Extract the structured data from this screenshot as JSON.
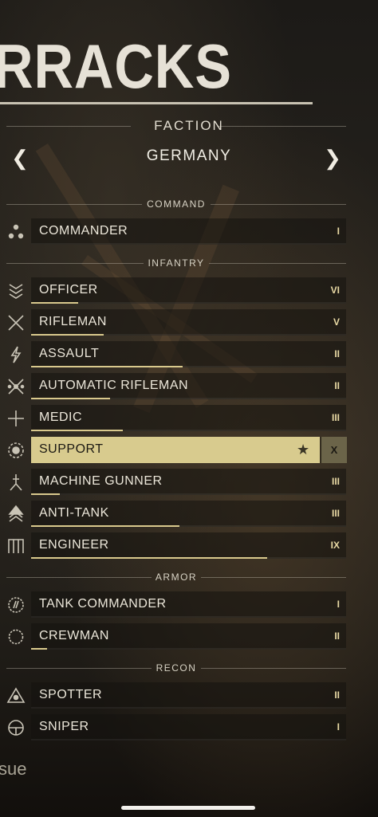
{
  "title": "RRACKS",
  "faction": {
    "label": "FACTION",
    "name": "GERMANY",
    "prev_icon": "chevron-left-icon",
    "next_icon": "chevron-right-icon"
  },
  "sections": {
    "command": "COMMAND",
    "infantry": "INFANTRY",
    "armor": "ARMOR",
    "recon": "RECON"
  },
  "roles": {
    "commander": {
      "label": "COMMANDER",
      "rank": "I",
      "xp": 0.0,
      "icon": "commander-icon"
    },
    "officer": {
      "label": "OFFICER",
      "rank": "VI",
      "xp": 0.15,
      "icon": "officer-icon"
    },
    "rifleman": {
      "label": "RIFLEMAN",
      "rank": "V",
      "xp": 0.23,
      "icon": "rifleman-icon"
    },
    "assault": {
      "label": "ASSAULT",
      "rank": "II",
      "xp": 0.48,
      "icon": "assault-icon"
    },
    "automatic_rifleman": {
      "label": "AUTOMATIC RIFLEMAN",
      "rank": "II",
      "xp": 0.25,
      "icon": "automatic-rifleman-icon"
    },
    "medic": {
      "label": "MEDIC",
      "rank": "III",
      "xp": 0.29,
      "icon": "medic-icon"
    },
    "support": {
      "label": "SUPPORT",
      "rank": "X",
      "xp": 1.0,
      "icon": "support-icon",
      "selected": true
    },
    "machine_gunner": {
      "label": "MACHINE GUNNER",
      "rank": "III",
      "xp": 0.09,
      "icon": "machine-gunner-icon"
    },
    "anti_tank": {
      "label": "ANTI-TANK",
      "rank": "III",
      "xp": 0.47,
      "icon": "anti-tank-icon"
    },
    "engineer": {
      "label": "ENGINEER",
      "rank": "IX",
      "xp": 0.75,
      "icon": "engineer-icon"
    },
    "tank_commander": {
      "label": "TANK COMMANDER",
      "rank": "I",
      "xp": 0.0,
      "icon": "tank-commander-icon"
    },
    "crewman": {
      "label": "CREWMAN",
      "rank": "II",
      "xp": 0.05,
      "icon": "crewman-icon"
    },
    "spotter": {
      "label": "SPOTTER",
      "rank": "II",
      "xp": 0.0,
      "icon": "spotter-icon"
    },
    "sniper": {
      "label": "SNIPER",
      "rank": "I",
      "xp": 0.0,
      "icon": "sniper-icon"
    }
  },
  "footer_text": "sue",
  "colors": {
    "accent": "#d8cb8e",
    "xp_bar": "#d9c98d"
  }
}
